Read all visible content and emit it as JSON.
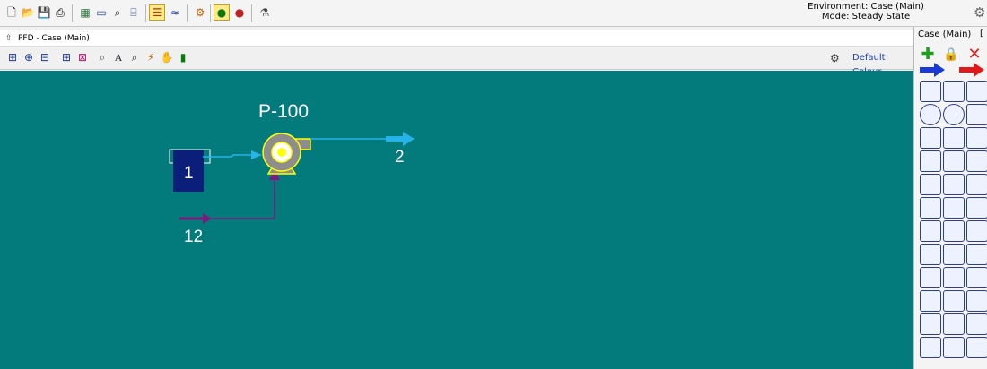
{
  "top_toolbar": {
    "environment_label": "Environment: Case (Main)",
    "mode_label": "Mode: Steady State",
    "buttons": [
      "new-icon",
      "open-icon",
      "save-icon",
      "print-icon",
      "workbook-icon",
      "pfd-icon",
      "find-icon",
      "object-navigator-icon",
      "hysys-sheet-icon",
      "column-icon",
      "utilities-icon",
      "solver-active-icon",
      "solver-hold-icon",
      "flask-icon"
    ]
  },
  "pfd_window": {
    "title": "PFD - Case (Main)",
    "colour_scheme": "Default Colour"
  },
  "pfd": {
    "pump_label": "P-100",
    "stream_feed": "1",
    "stream_product": "2",
    "stream_energy": "12"
  },
  "palette": {
    "title": "Case (Main)"
  },
  "colors": {
    "canvas": "#037b7c",
    "material_stream": "#26b4e8",
    "energy_stream": "#7d1a7d",
    "feed_box": "#0b1f7a",
    "pump_body": "#8d8d8d",
    "pump_outline": "#ffff00"
  }
}
